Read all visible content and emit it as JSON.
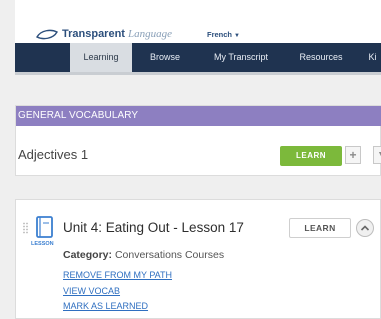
{
  "header": {
    "brand": "Transparent",
    "brand_suffix": "Language",
    "language_select": "French",
    "accent_color": "#2c4f7c"
  },
  "nav": {
    "tabs": [
      "Learning",
      "Browse",
      "My Transcript",
      "Resources",
      "Ki"
    ],
    "active_tab": "Learning",
    "background": "#1f3350"
  },
  "vocab_card": {
    "header": "GENERAL VOCABULARY",
    "header_color": "#8d7fc1",
    "title": "Adjectives 1",
    "learn_label": "LEARN",
    "learn_color": "#7cb93b",
    "add_icon": "plus-icon",
    "menu_icon": "chevron-down-icon"
  },
  "lesson_card": {
    "icon": "lesson-book-icon",
    "icon_tag": "LESSON",
    "title": "Unit 4: Eating Out - Lesson 17",
    "learn_label": "LEARN",
    "collapse_icon": "chevron-up-icon",
    "category_label": "Category:",
    "category_value": "Conversations Courses",
    "links": [
      "REMOVE FROM MY PATH",
      "VIEW VOCAB",
      "MARK AS LEARNED"
    ],
    "link_color": "#2f6fc0"
  }
}
